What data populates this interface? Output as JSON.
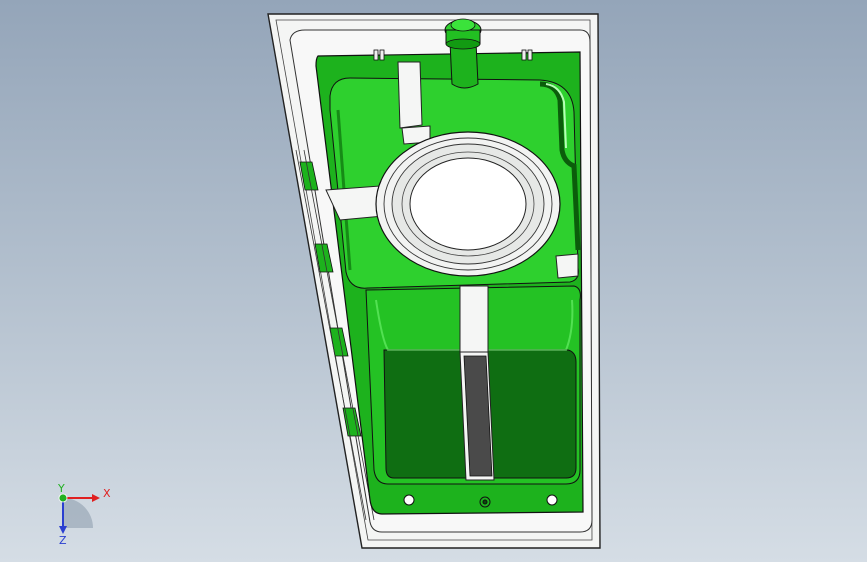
{
  "viewport": {
    "background_top": "#94a5b9",
    "background_bottom": "#d5dde5"
  },
  "model": {
    "mold_color": "#f4f5f4",
    "cavity_color": "#1db21d",
    "cavity_dark": "#0f6e12",
    "edge_color": "#1a1a1a",
    "icon": "tank-mold-model"
  },
  "triad": {
    "x_label": "X",
    "y_label": "Y",
    "z_label": "Z",
    "x_color": "#e02020",
    "y_color": "#22b022",
    "z_color": "#2a3fd0"
  }
}
